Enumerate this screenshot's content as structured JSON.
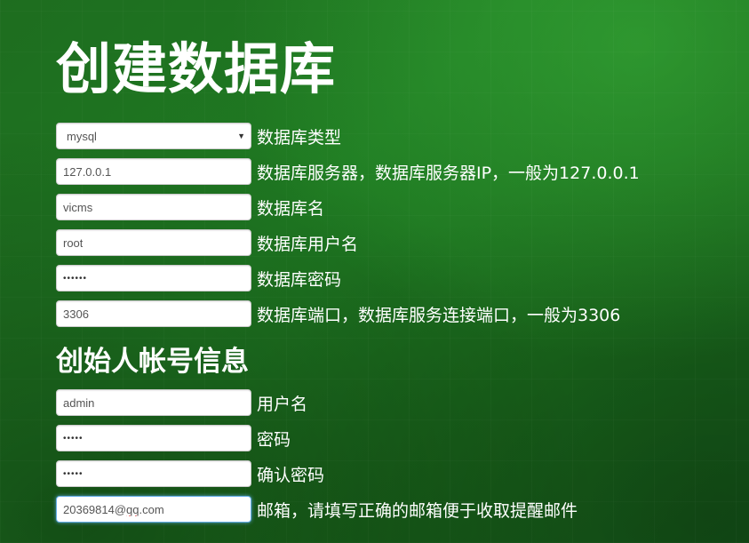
{
  "page": {
    "title": "创建数据库",
    "founder_section_title": "创始人帐号信息"
  },
  "database": {
    "type": {
      "value": "mysql",
      "label": "数据库类型"
    },
    "server": {
      "value": "127.0.0.1",
      "label": "数据库服务器，数据库服务器IP，一般为127.0.0.1"
    },
    "name": {
      "value": "vicms",
      "label": "数据库名"
    },
    "user": {
      "value": "root",
      "label": "数据库用户名"
    },
    "password": {
      "value": "••••••",
      "label": "数据库密码"
    },
    "port": {
      "value": "3306",
      "label": "数据库端口，数据库服务连接端口，一般为3306"
    }
  },
  "founder": {
    "username": {
      "value": "admin",
      "label": "用户名"
    },
    "password": {
      "value": "•••••",
      "label": "密码"
    },
    "confirm_password": {
      "value": "•••••",
      "label": "确认密码"
    },
    "email": {
      "value_user": "20369814@",
      "value_domain": "qq",
      "value_tld": ".com",
      "label": "邮箱，请填写正确的邮箱便于收取提醒邮件"
    }
  },
  "colors": {
    "background": "#1a6a1c",
    "text": "#ffffff",
    "input_border": "#cccccc",
    "focus_border": "#66afe9"
  },
  "icons": {
    "select_caret": "caret-down-icon"
  }
}
